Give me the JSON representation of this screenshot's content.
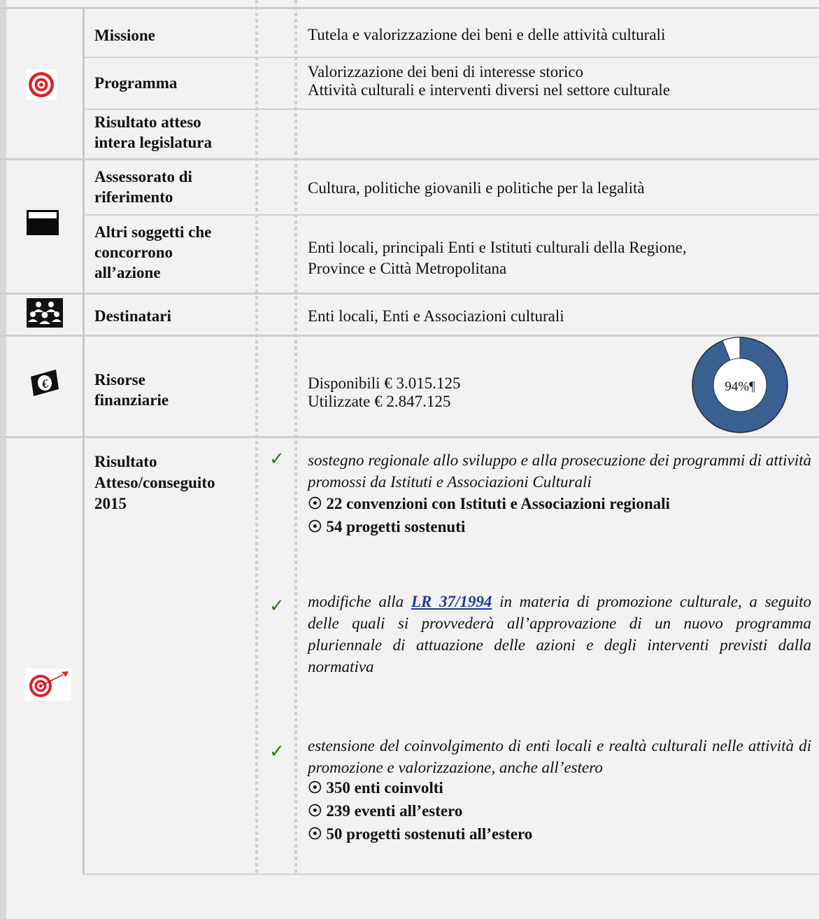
{
  "rows": {
    "missione": {
      "label": "Missione",
      "value": "Tutela e valorizzazione dei beni e delle attività culturali"
    },
    "programma": {
      "label": "Programma",
      "values": [
        "Valorizzazione dei beni di interesse storico",
        "Attività culturali e interventi diversi nel settore culturale"
      ]
    },
    "risultato_legislatura": {
      "label_lines": [
        "Risultato atteso",
        "intera legislatura"
      ],
      "value": ""
    },
    "assessorato": {
      "label_lines": [
        "Assessorato di",
        "riferimento"
      ],
      "value": "Cultura, politiche giovanili e politiche per la legalità"
    },
    "altri_soggetti": {
      "label_lines": [
        "Altri soggetti che",
        "concorrono",
        "all’azione"
      ],
      "value_lines": [
        "Enti locali, principali Enti e Istituti culturali della Regione,",
        "Province e Città Metropolitana"
      ]
    },
    "destinatari": {
      "label": "Destinatari",
      "value": "Enti locali, Enti e Associazioni culturali"
    },
    "risorse": {
      "label_lines": [
        "Risorse",
        "finanziarie"
      ],
      "disponibili": "Disponibili € 3.015.125",
      "utilizzate": "Utilizzate € 2.847.125",
      "donut_label": "94%¶",
      "donut_percent": 94,
      "colors": {
        "used": "#3a5f91",
        "remaining": "#ffffff",
        "outline": "#1f2a3a"
      }
    },
    "risultato_2015": {
      "label_lines": [
        "Risultato",
        "Atteso/conseguito",
        "2015"
      ],
      "items": [
        {
          "text": "sostegno regionale allo sviluppo e alla prosecuzione dei programmi di attività promossi da Istituti e Associazioni Culturali",
          "bullets": [
            "22 convenzioni con Istituti e Associazioni regionali",
            "54 progetti sostenuti"
          ]
        },
        {
          "text_before": "modifiche alla",
          "link": "LR 37/1994",
          "text_after": "in materia di promozione culturale, a seguito delle quali si provvederà all’approvazione di un nuovo programma pluriennale di attuazione delle azioni e degli interventi previsti dalla normativa"
        },
        {
          "text": "estensione del coinvolgimento di enti locali e realtà culturali nelle attività di promozione e valorizzazione, anche all’estero",
          "bullets": [
            "350 enti coinvolti",
            "239 eventi all’estero",
            "50 progetti sostenuti all’estero"
          ]
        }
      ]
    }
  },
  "symbols": {
    "check": "✓",
    "bullet": "☉"
  },
  "icons": [
    "target-icon",
    "flag-icon",
    "people-icon",
    "euro-icon",
    "target-dart-icon"
  ]
}
